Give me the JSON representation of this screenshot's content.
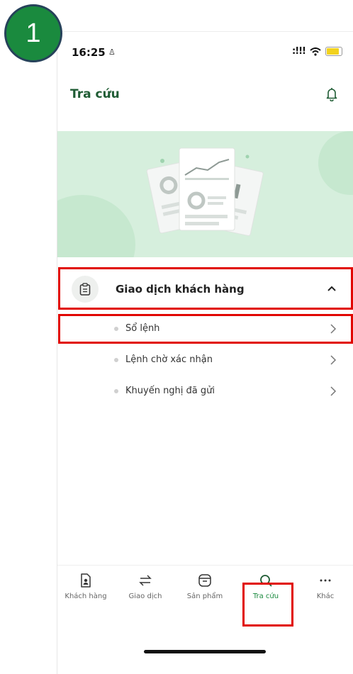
{
  "step": {
    "number": "1"
  },
  "status_bar": {
    "time": "16:25",
    "signal": ":!!!"
  },
  "header": {
    "title": "Tra cứu"
  },
  "section": {
    "title": "Giao dịch khách hàng",
    "items": [
      {
        "label": "Sổ lệnh"
      },
      {
        "label": "Lệnh chờ xác nhận"
      },
      {
        "label": "Khuyến nghị đã gửi"
      }
    ]
  },
  "bottom_nav": {
    "items": [
      {
        "label": "Khách hàng",
        "icon": "customer-icon"
      },
      {
        "label": "Giao dịch",
        "icon": "transfer-icon"
      },
      {
        "label": "Sản phẩm",
        "icon": "product-icon"
      },
      {
        "label": "Tra cứu",
        "icon": "search-icon",
        "active": true
      },
      {
        "label": "Khác",
        "icon": "more-icon"
      }
    ]
  },
  "colors": {
    "brand": "#1a8a3e",
    "title": "#1f5c34",
    "highlight": "#e10600",
    "hero": "#d6efdd"
  }
}
